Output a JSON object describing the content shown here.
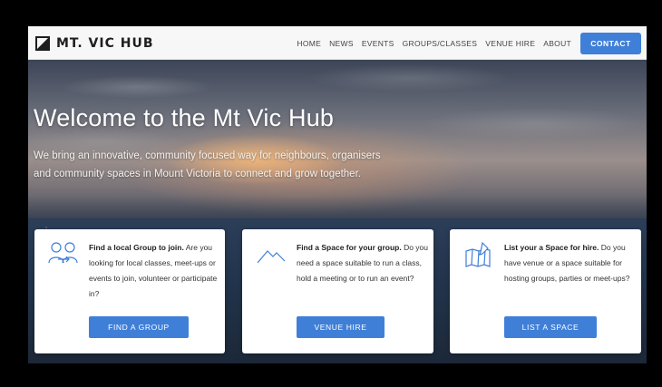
{
  "brand": {
    "name": "MT. VIC HUB"
  },
  "nav": {
    "links": [
      "HOME",
      "NEWS",
      "EVENTS",
      "GROUPS/CLASSES",
      "VENUE HIRE",
      "ABOUT"
    ],
    "contact_label": "CONTACT"
  },
  "hero": {
    "title": "Welcome to the Mt Vic Hub",
    "subtitle": "We bring an innovative, community focused way for neighbours, organisers and community spaces in Mount Victoria to connect and grow together."
  },
  "cards": [
    {
      "icon": "group-link-icon",
      "title": "Find a local Group to join.",
      "body": " Are you looking for local classes, meet-ups or events to join, volunteer or participate in?",
      "button": "FIND A GROUP"
    },
    {
      "icon": "mountain-icon",
      "title": "Find a Space for your group.",
      "body": " Do you need a space suitable to run a class, hold a meeting or to run an event?",
      "button": "VENUE HIRE"
    },
    {
      "icon": "map-pin-icon",
      "title": "List your a Space for hire.",
      "body": " Do you have venue or a space suitable for hosting groups, parties or meet-ups?",
      "button": "LIST A SPACE"
    }
  ],
  "colors": {
    "accent": "#3f7fd8",
    "nav_bg": "#f7f7f7",
    "card_bg": "#ffffff",
    "icon_stroke": "#3f7fd8"
  }
}
